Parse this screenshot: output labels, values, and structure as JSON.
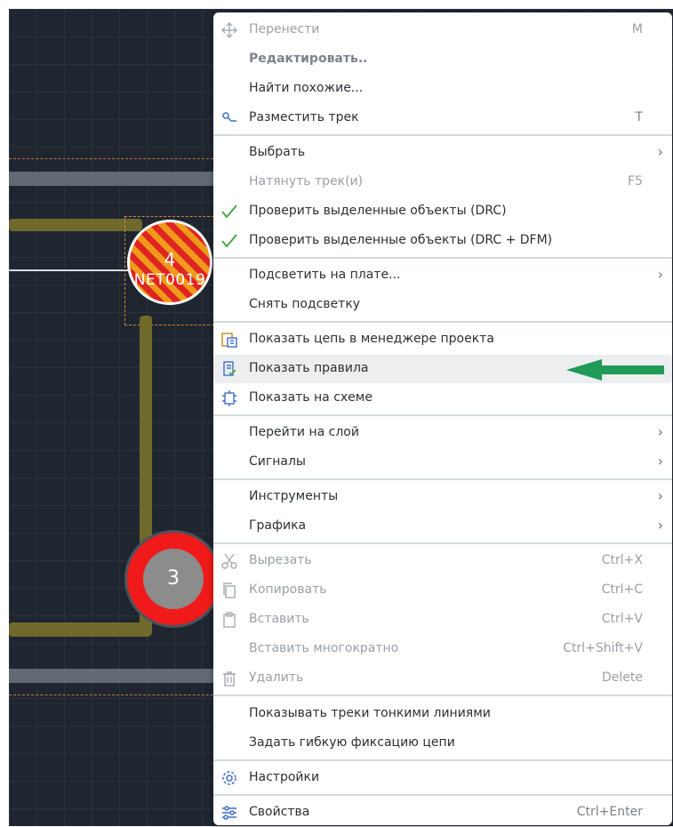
{
  "board": {
    "pad4": {
      "number": "4",
      "net": "NET0019"
    },
    "pad3": {
      "number": "3"
    }
  },
  "menu": {
    "move": {
      "label": "Перенести",
      "shortcut": "M",
      "icon": "move-icon"
    },
    "edit": {
      "label": "Редактировать.."
    },
    "find_similar": {
      "label": "Найти похожие..."
    },
    "place_track": {
      "label": "Разместить трек",
      "shortcut": "T",
      "icon": "route-track-icon"
    },
    "select": {
      "label": "Выбрать"
    },
    "stretch_tracks": {
      "label": "Натянуть трек(и)",
      "shortcut": "F5"
    },
    "check_drc": {
      "label": "Проверить выделенные объекты (DRC)",
      "icon": "checkmark-icon"
    },
    "check_drc_dfm": {
      "label": "Проверить выделенные объекты (DRC + DFM)",
      "icon": "checkmark-icon"
    },
    "highlight_on_board": {
      "label": "Подсветить на плате..."
    },
    "clear_highlight": {
      "label": "Снять подсветку"
    },
    "show_net_in_manager": {
      "label": "Показать цепь в менеджере проекта",
      "icon": "project-manager-icon"
    },
    "show_rules": {
      "label": "Показать правила",
      "icon": "rules-icon"
    },
    "show_on_schematic": {
      "label": "Показать на схеме",
      "icon": "schematic-icon"
    },
    "go_to_layer": {
      "label": "Перейти на слой"
    },
    "signals": {
      "label": "Сигналы"
    },
    "tools": {
      "label": "Инструменты"
    },
    "graphics": {
      "label": "Графика"
    },
    "cut": {
      "label": "Вырезать",
      "shortcut": "Ctrl+X",
      "icon": "scissors-icon"
    },
    "copy": {
      "label": "Копировать",
      "shortcut": "Ctrl+C",
      "icon": "copy-icon"
    },
    "paste": {
      "label": "Вставить",
      "shortcut": "Ctrl+V",
      "icon": "clipboard-icon"
    },
    "paste_multiple": {
      "label": "Вставить многократно",
      "shortcut": "Ctrl+Shift+V"
    },
    "delete": {
      "label": "Удалить",
      "shortcut": "Delete",
      "icon": "trash-icon"
    },
    "thin_tracks": {
      "label": "Показывать треки тонкими линиями"
    },
    "flexible_fix": {
      "label": "Задать гибкую фиксацию цепи"
    },
    "settings": {
      "label": "Настройки",
      "icon": "gear-icon"
    },
    "properties": {
      "label": "Свойства",
      "shortcut": "Ctrl+Enter",
      "icon": "sliders-icon"
    },
    "submenu_arrow": "›"
  },
  "colors": {
    "canvas_bg": "#1f2630",
    "menu_bg": "#ffffff",
    "highlight_row": "#eceef0",
    "annotation_arrow": "#1f9a57",
    "pad_red": "#f11a1a",
    "pad_orange": "#f09a1a",
    "accent_blue": "#3f6fc9",
    "check_green": "#49a843"
  }
}
